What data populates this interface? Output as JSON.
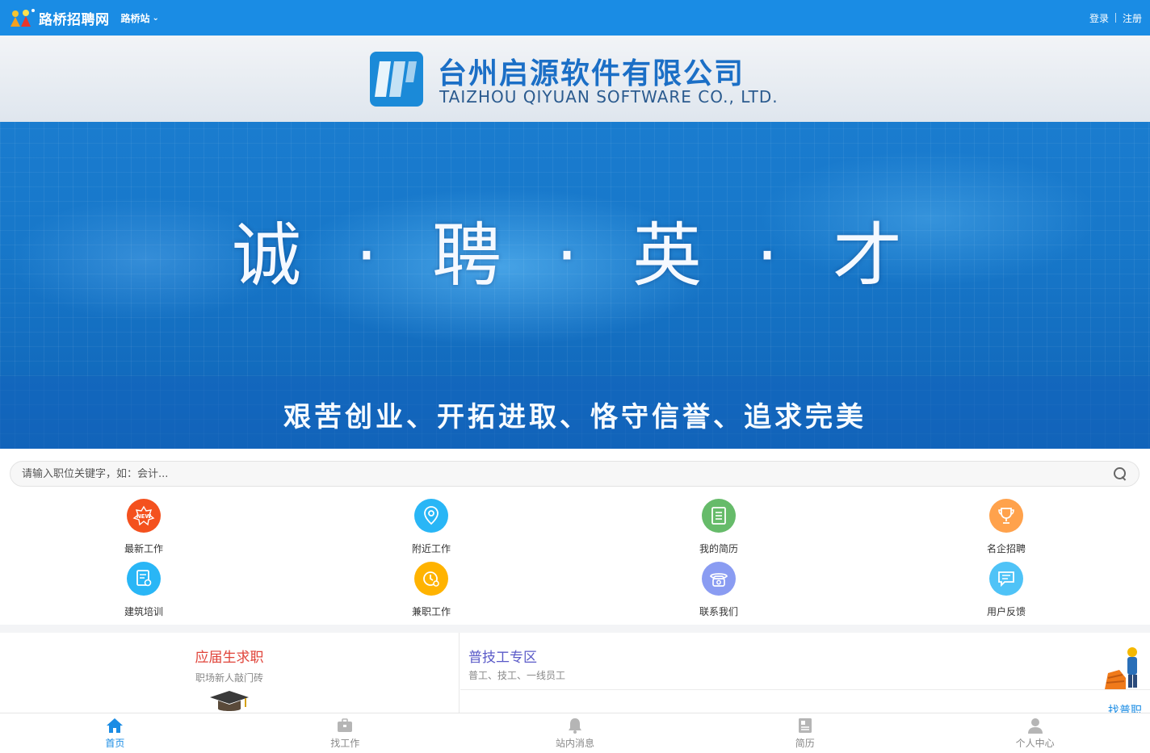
{
  "header": {
    "site_name": "路桥招聘网",
    "station_label": "路桥站",
    "login_label": "登录",
    "register_label": "注册"
  },
  "banner": {
    "company_cn": "台州启源软件有限公司",
    "company_en": "TAIZHOU QIYUAN  SOFTWARE CO., LTD.",
    "slogan": "诚 · 聘 · 英 · 才",
    "motto": "艰苦创业、开拓进取、恪守信誉、追求完美"
  },
  "search": {
    "placeholder": "请输入职位关键字，如：会计..."
  },
  "categories": [
    {
      "label": "最新工作",
      "icon": "new-badge-icon",
      "color": "#f4511e"
    },
    {
      "label": "附近工作",
      "icon": "location-pin-icon",
      "color": "#29b6f6"
    },
    {
      "label": "我的简历",
      "icon": "resume-doc-icon",
      "color": "#66bb6a"
    },
    {
      "label": "名企招聘",
      "icon": "trophy-icon",
      "color": "#ffa24c"
    },
    {
      "label": "建筑培训",
      "icon": "certificate-icon",
      "color": "#29b6f6"
    },
    {
      "label": "兼职工作",
      "icon": "clock-icon",
      "color": "#ffb300"
    },
    {
      "label": "联系我们",
      "icon": "telephone-icon",
      "color": "#8a9cf2"
    },
    {
      "label": "用户反馈",
      "icon": "feedback-icon",
      "color": "#4fc3f7"
    }
  ],
  "sections": {
    "graduate_title": "应届生求职",
    "graduate_sub": "职场新人敲门砖",
    "worker_title": "普技工专区",
    "worker_sub": "普工、技工、一线员工",
    "worker_link": "找普职"
  },
  "bottom_nav": [
    {
      "label": "首页",
      "icon": "home-icon",
      "active": true
    },
    {
      "label": "找工作",
      "icon": "briefcase-icon",
      "active": false
    },
    {
      "label": "站内消息",
      "icon": "bell-icon",
      "active": false
    },
    {
      "label": "简历",
      "icon": "resume-icon",
      "active": false
    },
    {
      "label": "个人中心",
      "icon": "user-icon",
      "active": false
    }
  ],
  "colors": {
    "primary": "#1a8ce4",
    "graduate_title": "#e0443a",
    "worker_title": "#5a5ac8"
  }
}
